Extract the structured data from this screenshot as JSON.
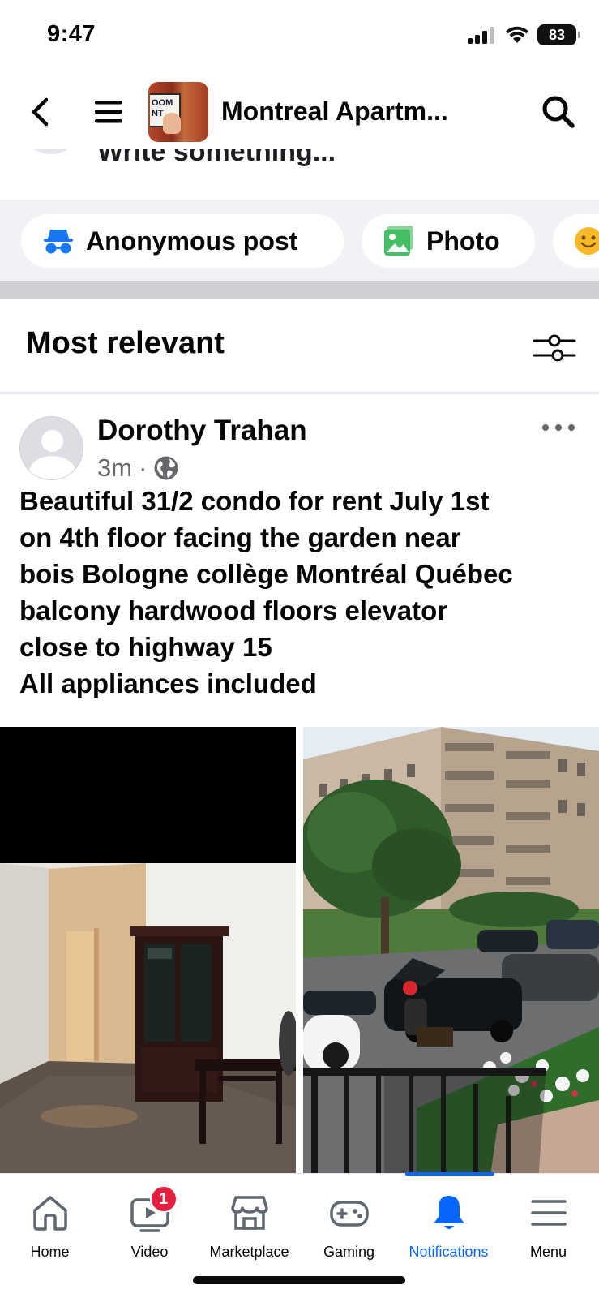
{
  "status_bar": {
    "time": "9:47",
    "battery": "83"
  },
  "header": {
    "title": "Montreal Apartm...",
    "thumb_sign_text": "OOM NT"
  },
  "composer": {
    "placeholder": "Write something..."
  },
  "chips": {
    "anonymous": "Anonymous post",
    "photo": "Photo"
  },
  "sort": {
    "label": "Most relevant"
  },
  "post": {
    "author": "Dorothy Trahan",
    "time": "3m",
    "separator": "·",
    "text_lines": [
      "Beautiful 31/2 condo for rent July 1st",
      "on 4th floor facing the garden  near",
      "bois Bologne collège Montréal Québec",
      "balcony hardwood floors elevator",
      "close to highway 15",
      "All appliances included"
    ]
  },
  "nav": {
    "items": [
      {
        "label": "Home",
        "icon": "home-icon"
      },
      {
        "label": "Video",
        "icon": "video-icon",
        "badge": "1"
      },
      {
        "label": "Marketplace",
        "icon": "marketplace-icon"
      },
      {
        "label": "Gaming",
        "icon": "gaming-icon"
      },
      {
        "label": "Notifications",
        "icon": "bell-icon",
        "active": true
      },
      {
        "label": "Menu",
        "icon": "menu-icon"
      }
    ]
  },
  "colors": {
    "accent": "#0866ff",
    "badge": "#e41e3f",
    "secondary_text": "#65676b",
    "surface": "#f0f2f5"
  }
}
